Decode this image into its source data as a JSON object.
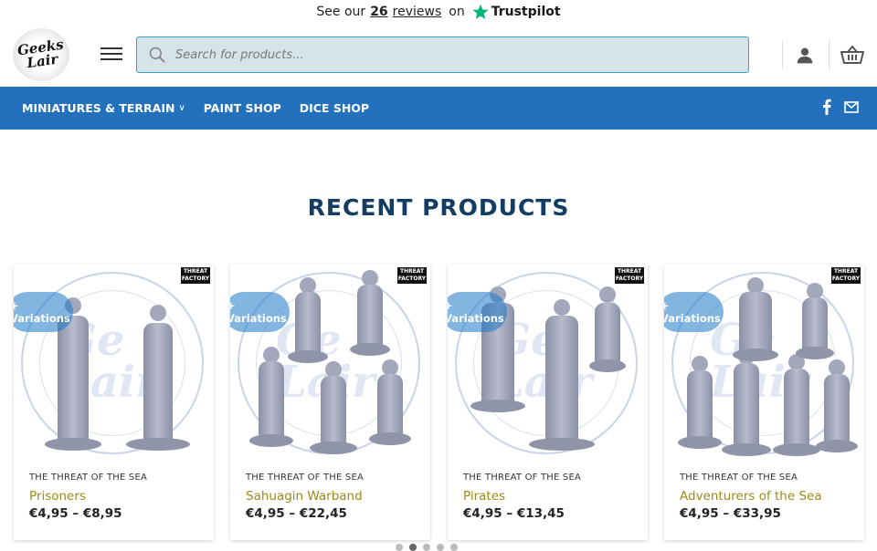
{
  "topbar": {
    "prefix": "See our",
    "count": "26",
    "reviews": "reviews",
    "on": "on",
    "brand": "Trustpilot",
    "brand_color": "#00b67a"
  },
  "header": {
    "logo_line1": "Geeks",
    "logo_line2": "Lair",
    "search_placeholder": "Search for products...",
    "icons": [
      "menu-icon",
      "search-icon",
      "user-icon",
      "basket-icon"
    ]
  },
  "nav": {
    "bg_color": "#2371bd",
    "items": [
      {
        "label": "MINIATURES & TERRAIN",
        "has_dropdown": true
      },
      {
        "label": "PAINT SHOP",
        "has_dropdown": false
      },
      {
        "label": "DICE SHOP",
        "has_dropdown": false
      }
    ],
    "social": [
      "facebook-icon",
      "envelope-icon"
    ]
  },
  "section": {
    "title": "RECENT PRODUCTS"
  },
  "products": [
    {
      "badge": "THREAT FACTORY",
      "variations": "+ Variations",
      "category": "THE THREAT OF THE SEA",
      "name": "Prisoners",
      "price": "€4,95 – €8,95"
    },
    {
      "badge": "THREAT FACTORY",
      "variations": "+ Variations",
      "category": "THE THREAT OF THE SEA",
      "name": "Sahuagin Warband",
      "price": "€4,95 – €22,45"
    },
    {
      "badge": "THREAT FACTORY",
      "variations": "+ Variations",
      "category": "THE THREAT OF THE SEA",
      "name": "Pirates",
      "price": "€4,95 – €13,45"
    },
    {
      "badge": "THREAT FACTORY",
      "variations": "+ Variations",
      "category": "THE THREAT OF THE SEA",
      "name": "Adventurers of the Sea",
      "price": "€4,95 – €33,95"
    }
  ],
  "colors": {
    "title": "#143d63",
    "product_name": "#9c8a18",
    "search_bg": "#d6e4ea",
    "search_border": "#3aa0c8"
  }
}
